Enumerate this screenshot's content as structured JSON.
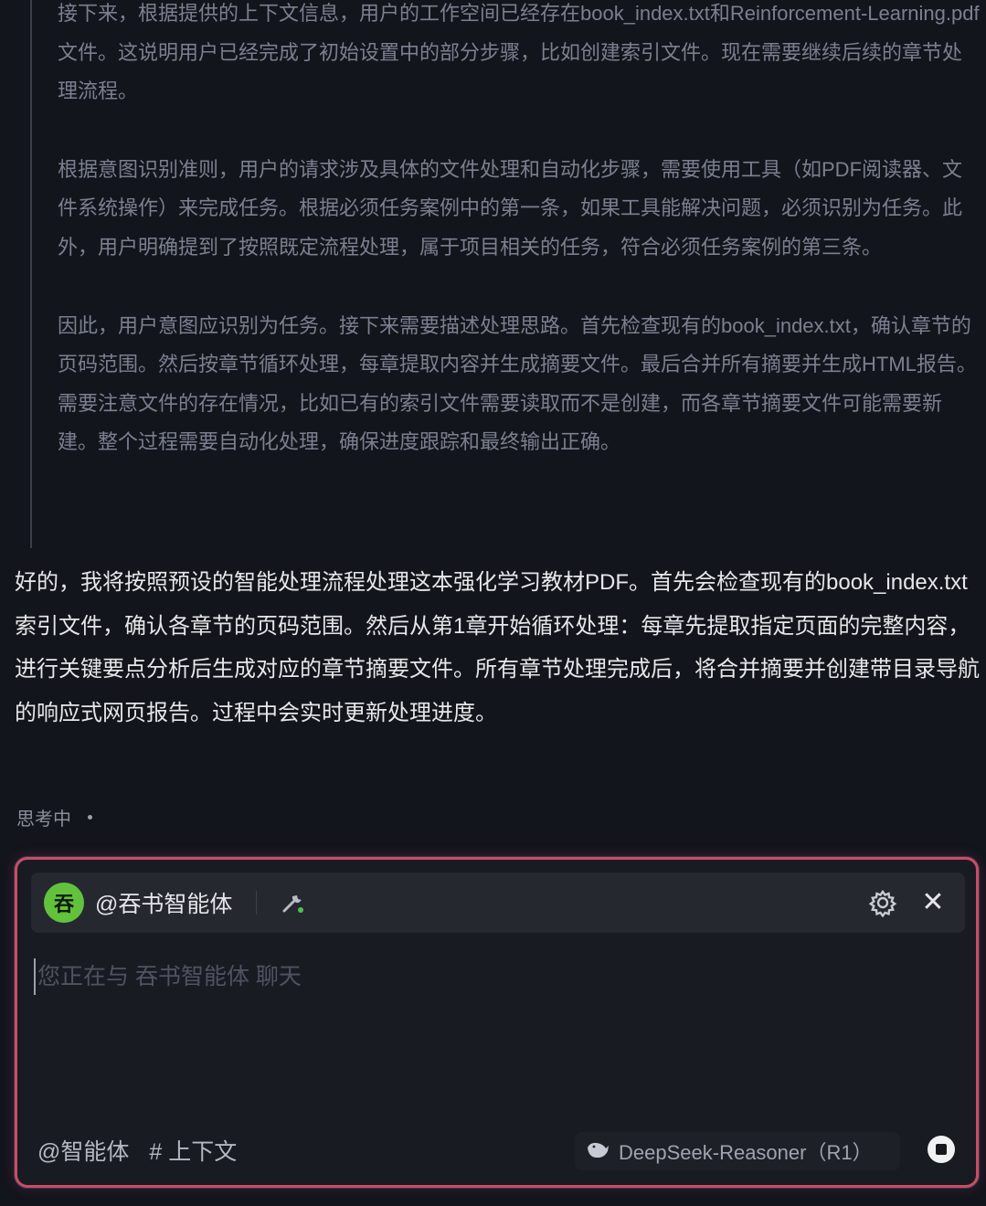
{
  "reasoning": {
    "paragraphs": [
      "接下来，根据提供的上下文信息，用户的工作空间已经存在book_index.txt和Reinforcement-Learning.pdf文件。这说明用户已经完成了初始设置中的部分步骤，比如创建索引文件。现在需要继续后续的章节处理流程。",
      "根据意图识别准则，用户的请求涉及具体的文件处理和自动化步骤，需要使用工具（如PDF阅读器、文件系统操作）来完成任务。根据必须任务案例中的第一条，如果工具能解决问题，必须识别为任务。此外，用户明确提到了按照既定流程处理，属于项目相关的任务，符合必须任务案例的第三条。",
      "因此，用户意图应识别为任务。接下来需要描述处理思路。首先检查现有的book_index.txt，确认章节的页码范围。然后按章节循环处理，每章提取内容并生成摘要文件。最后合并所有摘要并生成HTML报告。需要注意文件的存在情况，比如已有的索引文件需要读取而不是创建，而各章节摘要文件可能需要新建。整个过程需要自动化处理，确保进度跟踪和最终输出正确。"
    ]
  },
  "answer": "好的，我将按照预设的智能处理流程处理这本强化学习教材PDF。首先会检查现有的book_index.txt索引文件，确认各章节的页码范围。然后从第1章开始循环处理：每章先提取指定页面的完整内容，进行关键要点分析后生成对应的章节摘要文件。所有章节处理完成后，将合并摘要并创建带目录导航的响应式网页报告。过程中会实时更新处理进度。",
  "status": "思考中",
  "composer": {
    "agent_avatar_char": "吞",
    "agent_name": "@吞书智能体",
    "placeholder": "您正在与 吞书智能体 聊天",
    "value": "",
    "mention_agent": "@智能体",
    "mention_context": "# 上下文",
    "model": "DeepSeek-Reasoner（R1）",
    "icons": [
      "tool-icon",
      "gear-icon",
      "close-icon",
      "whale-icon",
      "stop-icon"
    ]
  },
  "colors": {
    "background": "#13151c",
    "reasoning_text": "#7b8090",
    "answer_text": "#e6e7ea",
    "avatar": "#63c23c",
    "border_accent": "#c94d63"
  }
}
